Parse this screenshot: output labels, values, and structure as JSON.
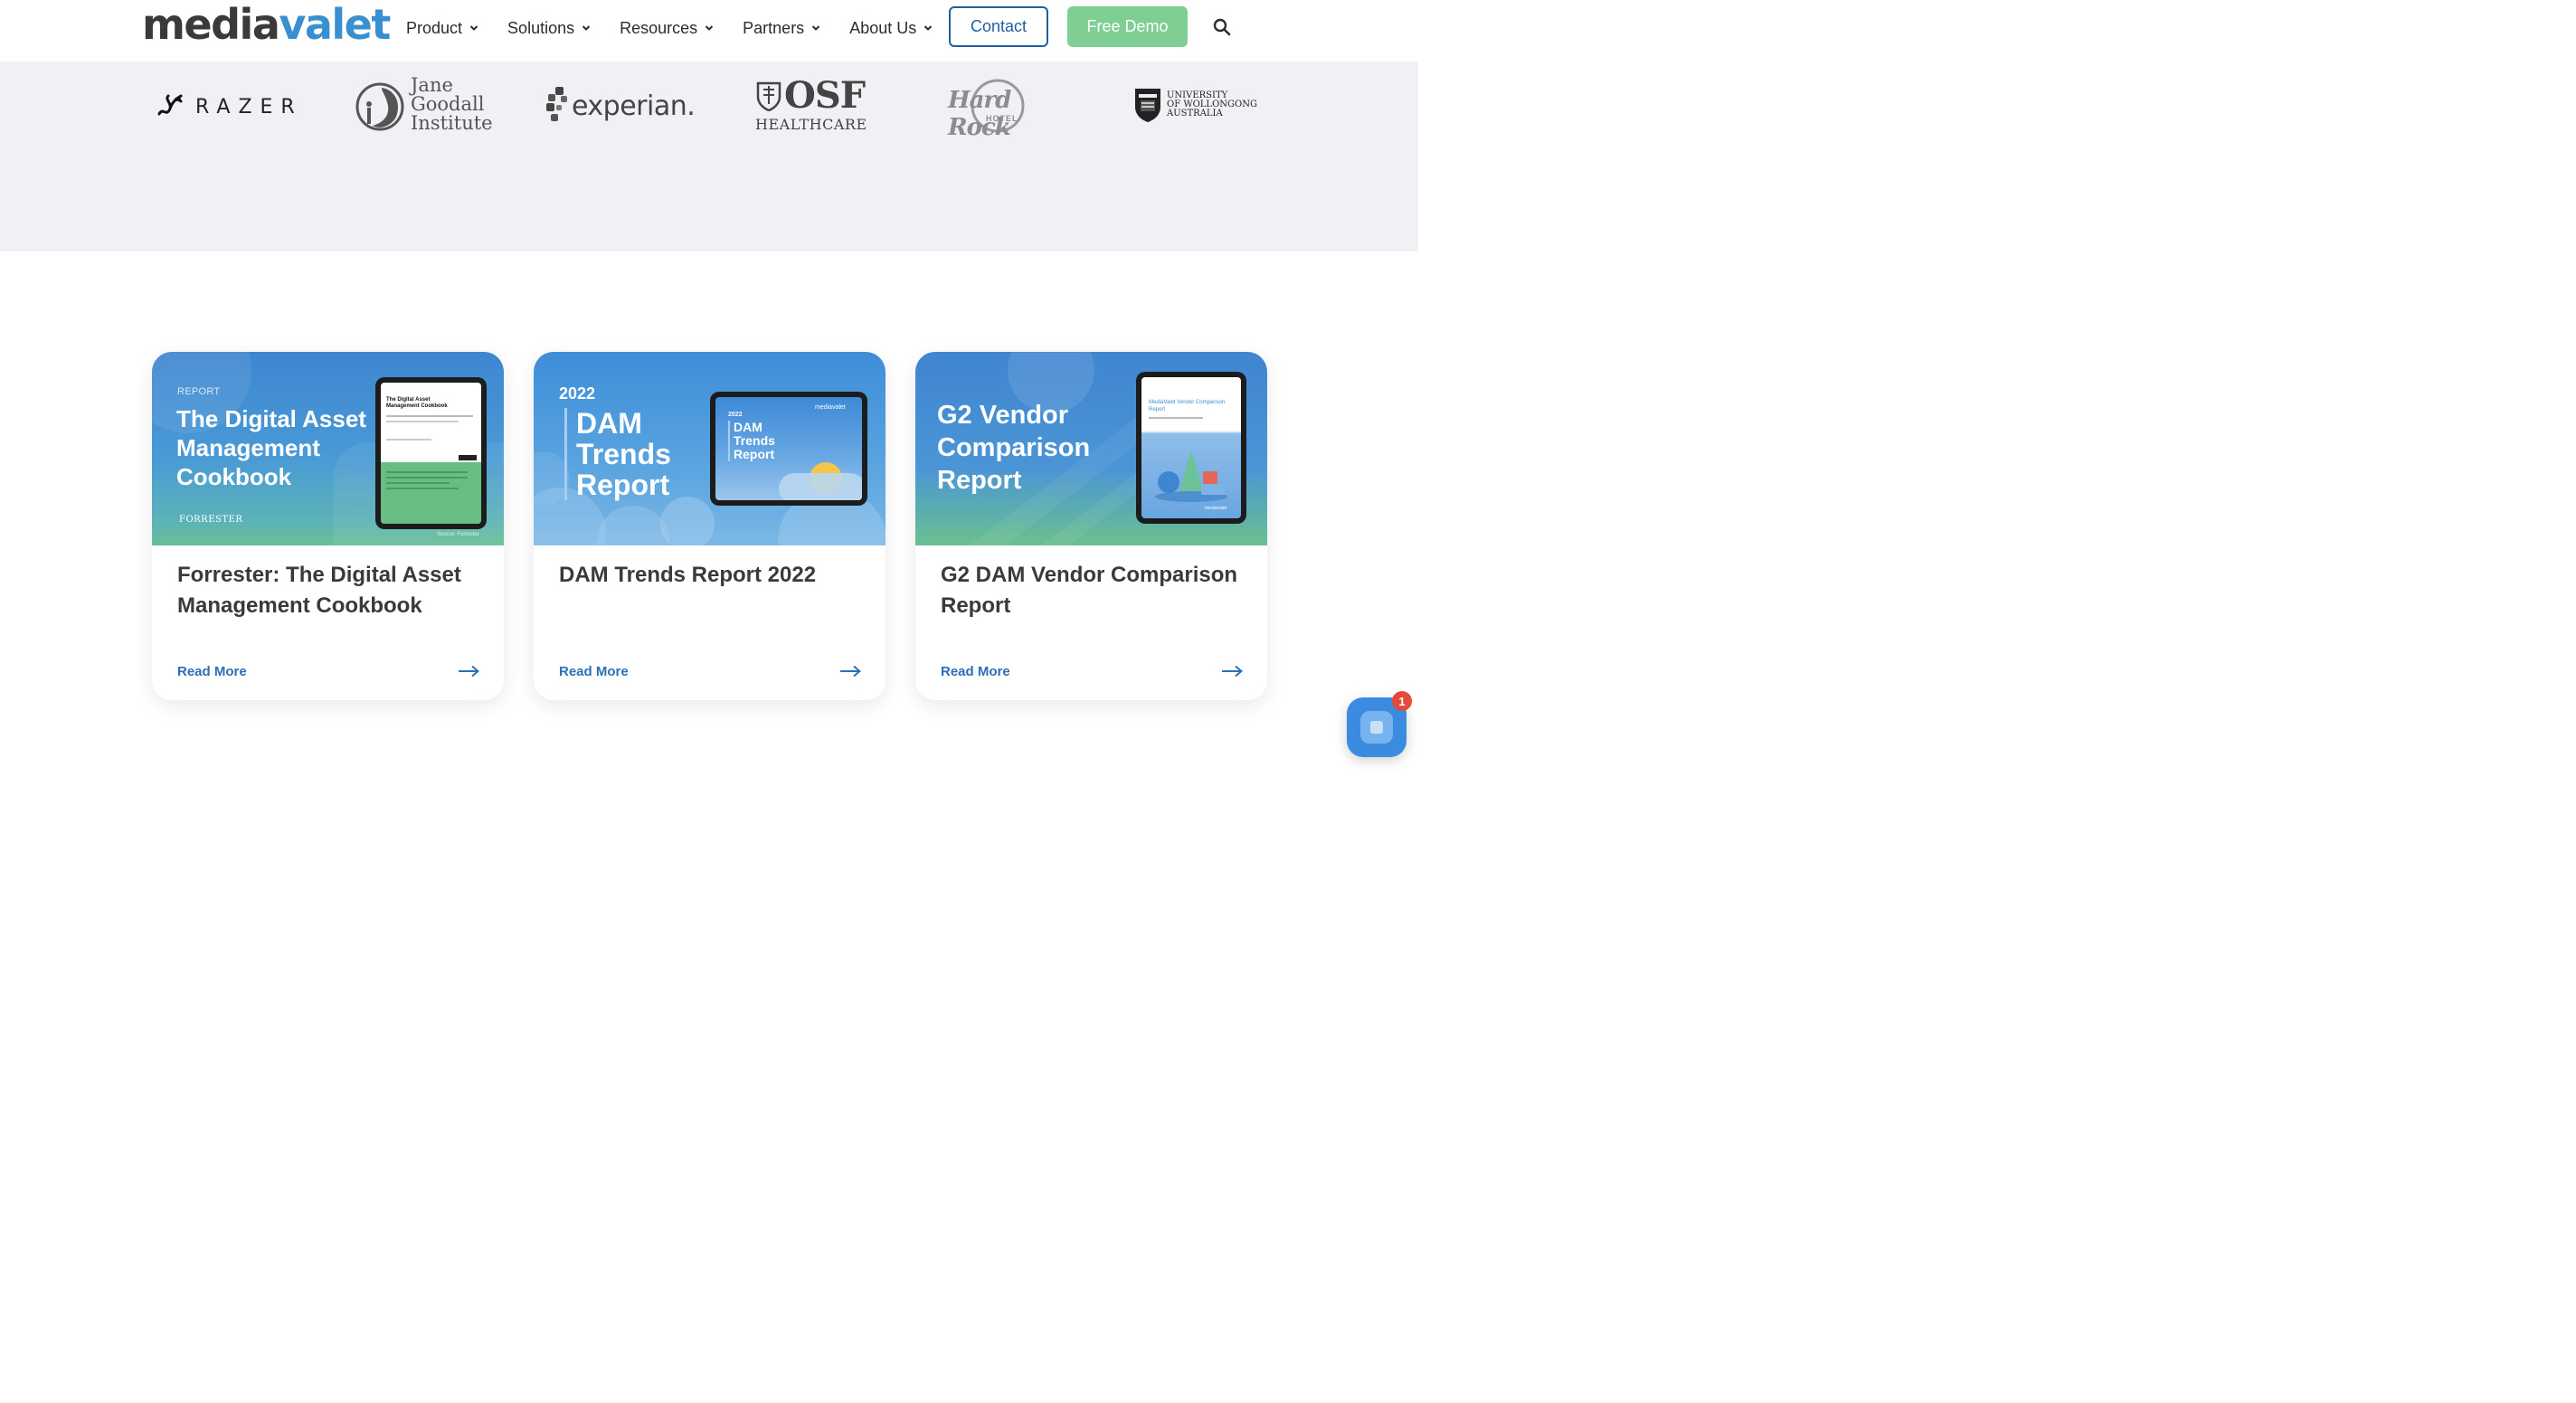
{
  "header": {
    "logo_part1": "media",
    "logo_part2": "valet",
    "nav": [
      {
        "label": "Product"
      },
      {
        "label": "Solutions"
      },
      {
        "label": "Resources"
      },
      {
        "label": "Partners"
      },
      {
        "label": "About Us"
      }
    ],
    "contact_label": "Contact",
    "demo_label": "Free Demo"
  },
  "clients": {
    "razer": "RAZER",
    "jane_line1": "Jane",
    "jane_line2": "Goodall",
    "jane_line3": "Institute",
    "experian": "experian.",
    "osf": "OSF",
    "osf_sub": "HEALTHCARE",
    "hardrock": "Hard Rock",
    "hardrock_sub": "HOTEL",
    "uow_line1": "UNIVERSITY",
    "uow_line2": "OF WOLLONGONG",
    "uow_line3": "AUSTRALIA"
  },
  "cards": [
    {
      "img_kicker": "REPORT",
      "img_title": "The Digital Asset Management Cookbook",
      "img_brand": "FORRESTER",
      "img_source": "Source: Forrester",
      "screen_title": "The Digital Asset Management Cookbook",
      "title": "Forrester: The Digital Asset Management Cookbook",
      "link": "Read More"
    },
    {
      "img_year": "2022",
      "img_title": "DAM Trends Report",
      "screen_brand": "mediavalet",
      "screen_year": "2022",
      "screen_title": "DAM Trends Report",
      "title": "DAM Trends Report 2022",
      "link": "Read More"
    },
    {
      "img_title": "G2 Vendor Comparison Report",
      "screen_title": "MediaValet Vendor Comparison Report",
      "screen_brand": "mediavalet",
      "title": "G2 DAM Vendor Comparison Report",
      "link": "Read More"
    }
  ],
  "chat": {
    "badge": "1"
  },
  "colors": {
    "brand_blue": "#3a8fd0",
    "contact_border": "#1f5f9f",
    "demo_green": "#7fcf95",
    "link_blue": "#2b6fb6",
    "badge_red": "#e5493a"
  }
}
